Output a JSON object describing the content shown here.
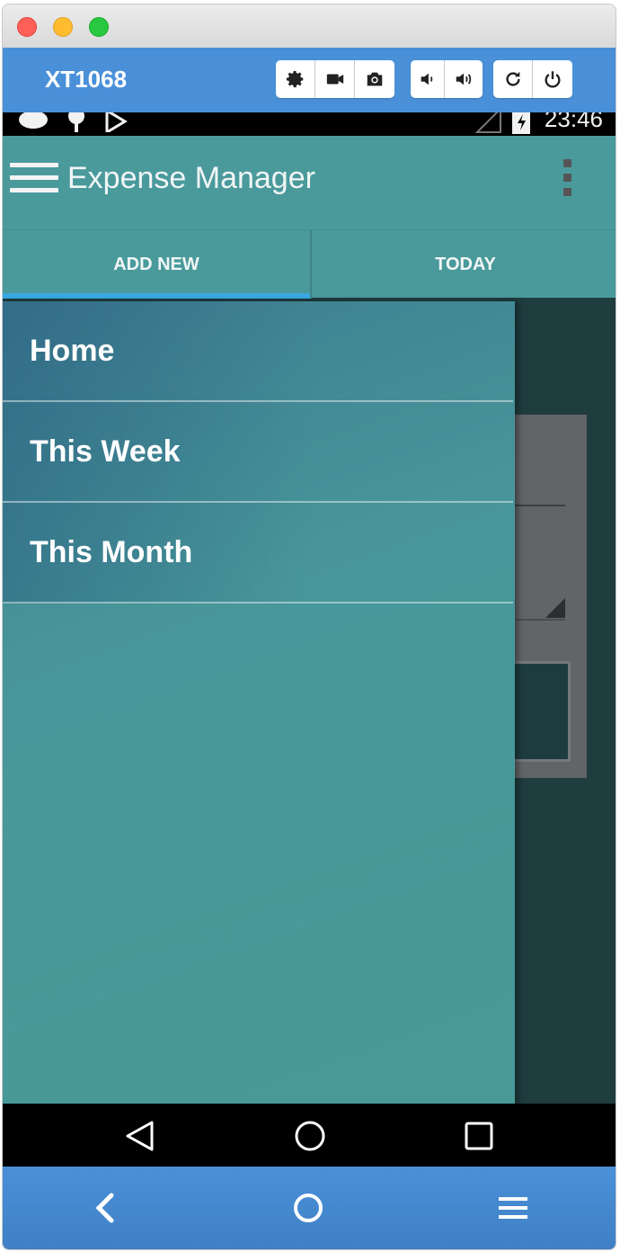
{
  "device": {
    "name": "XT1068"
  },
  "toolbar": {
    "buttons": [
      {
        "icon": "gear-icon"
      },
      {
        "icon": "video-camera-icon"
      },
      {
        "icon": "camera-icon"
      },
      {
        "icon": "volume-down-icon"
      },
      {
        "icon": "volume-up-icon"
      },
      {
        "icon": "rotate-icon"
      },
      {
        "icon": "power-icon"
      }
    ]
  },
  "status_bar": {
    "time": "23:46"
  },
  "app": {
    "title": "Expense Manager",
    "tabs": [
      {
        "label": "ADD NEW",
        "selected": true
      },
      {
        "label": "TODAY",
        "selected": false
      }
    ]
  },
  "drawer": {
    "items": [
      {
        "label": "Home"
      },
      {
        "label": "This Week"
      },
      {
        "label": "This Month"
      }
    ]
  },
  "colors": {
    "window_toolbar": "#4a90d9",
    "app_bar": "#4a9a9c",
    "tab_indicator": "#38a9e1",
    "drawer": "#48979a"
  }
}
